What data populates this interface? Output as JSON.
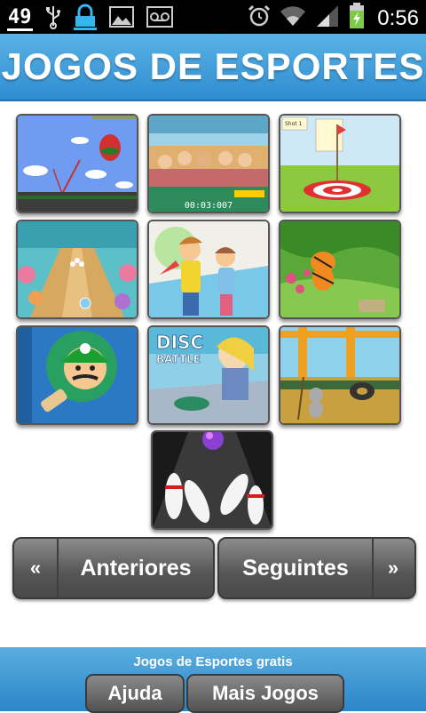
{
  "status_bar": {
    "notification_count": "49",
    "time": "0:56",
    "icons": [
      "notification-count-icon",
      "usb-icon",
      "lock-icon",
      "image-icon",
      "voicemail-icon",
      "alarm-icon",
      "wifi-icon",
      "signal-icon",
      "battery-charging-icon"
    ]
  },
  "header": {
    "title": "JOGOS DE ESPORTES"
  },
  "games": [
    {
      "name": "balloon-darts"
    },
    {
      "name": "tennis-crowd"
    },
    {
      "name": "archery"
    },
    {
      "name": "bowling-underwater"
    },
    {
      "name": "dance-couple"
    },
    {
      "name": "tiger-golf"
    },
    {
      "name": "mario-ping-pong"
    },
    {
      "name": "disc-battle"
    },
    {
      "name": "mouse-skate"
    },
    {
      "name": "bowling-pins"
    }
  ],
  "thumb_text": {
    "timer": "00:03:007",
    "shot": "Shot 1",
    "disc": "DISC",
    "battle": "BATTLE"
  },
  "pagination": {
    "prev_arrow": "«",
    "prev_label": "Anteriores",
    "next_label": "Seguintes",
    "next_arrow": "»"
  },
  "footer": {
    "tagline": "Jogos de Esportes gratis",
    "help_label": "Ajuda",
    "more_label": "Mais Jogos"
  },
  "colors": {
    "header_blue": "#3d9ad9",
    "button_gray": "#5e5e5e"
  }
}
